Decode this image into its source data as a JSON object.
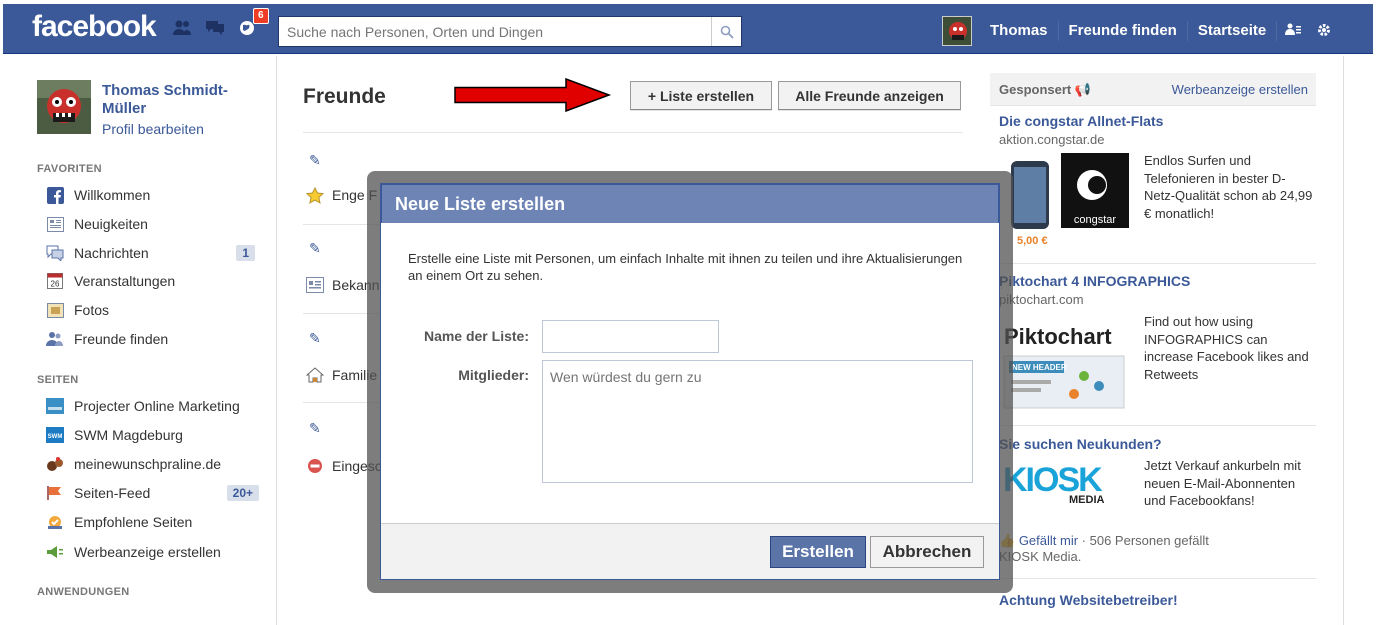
{
  "header": {
    "logo": "facebook",
    "notifications_count": "6",
    "search_placeholder": "Suche nach Personen, Orten und Dingen",
    "user_name": "Thomas",
    "find_friends": "Freunde finden",
    "home": "Startseite"
  },
  "sidebar": {
    "profile_name": "Thomas Schmidt-Müller",
    "edit_profile": "Profil bearbeiten",
    "favorites_heading": "FAVORITEN",
    "favorites": [
      {
        "label": "Willkommen",
        "icon": "facebook-f-icon"
      },
      {
        "label": "Neuigkeiten",
        "icon": "news-feed-icon"
      },
      {
        "label": "Nachrichten",
        "icon": "messages-icon",
        "count": "1"
      },
      {
        "label": "Veranstaltungen",
        "icon": "calendar-icon"
      },
      {
        "label": "Fotos",
        "icon": "photos-icon"
      },
      {
        "label": "Freunde finden",
        "icon": "friends-icon"
      }
    ],
    "pages_heading": "SEITEN",
    "pages": [
      {
        "label": "Projecter Online Marketing",
        "icon": "projecter-icon"
      },
      {
        "label": "SWM Magdeburg",
        "icon": "swm-icon"
      },
      {
        "label": "meinewunschpraline.de",
        "icon": "praline-icon"
      },
      {
        "label": "Seiten-Feed",
        "icon": "pages-feed-icon",
        "count": "20+"
      },
      {
        "label": "Empfohlene Seiten",
        "icon": "recommended-icon"
      },
      {
        "label": "Werbeanzeige erstellen",
        "icon": "create-ad-icon"
      }
    ],
    "apps_heading": "ANWENDUNGEN"
  },
  "main": {
    "title": "Freunde",
    "create_list_button": "+ Liste erstellen",
    "show_all_button": "Alle Freunde anzeigen",
    "lists": [
      {
        "label": "Enge F",
        "icon": "star-icon"
      },
      {
        "label": "Bekann",
        "icon": "acquaintances-icon"
      },
      {
        "label": "Familie",
        "icon": "house-icon"
      },
      {
        "label": "Eingesc",
        "icon": "restricted-icon"
      }
    ]
  },
  "dialog": {
    "title": "Neue Liste erstellen",
    "description": "Erstelle eine Liste mit Personen, um einfach Inhalte mit ihnen zu teilen und ihre Aktualisierungen an einem Ort zu sehen.",
    "name_label": "Name der Liste:",
    "name_value": "",
    "members_label": "Mitglieder:",
    "members_placeholder": "Wen würdest du gern zu",
    "create_button": "Erstellen",
    "cancel_button": "Abbrechen"
  },
  "ads": {
    "sponsored_label": "Gesponsert",
    "create_ad_link": "Werbeanzeige erstellen",
    "items": [
      {
        "title": "Die congstar Allnet-Flats",
        "domain": "aktion.congstar.de",
        "text": "Endlos Surfen und Telefonieren in bester D-Netz-Qualität schon ab 24,99 € monatlich!",
        "price_tag": "5,00 €",
        "brand": "congstar"
      },
      {
        "title": "Piktochart 4 INFOGRAPHICS",
        "domain": "piktochart.com",
        "text": "Find out how using INFOGRAPHICS can increase Facebook likes and Retweets",
        "brand": "Piktochart",
        "image_caption": "NEW HEADER"
      },
      {
        "title": "Sie suchen Neukunden?",
        "text": "Jetzt Verkauf ankurbeln mit neuen E-Mail-Abonnenten und Facebookfans!",
        "brand": "KIOSK",
        "brand_sub": "MEDIA",
        "like_label": "Gefällt mir",
        "social": "· 506 Personen gefällt",
        "social_2": "KIOSK Media."
      },
      {
        "title": "Achtung Websitebetreiber!"
      }
    ]
  },
  "colors": {
    "brand_blue": "#3b5998",
    "dialog_header": "#6d84b4",
    "arrow_red": "#e00000"
  }
}
